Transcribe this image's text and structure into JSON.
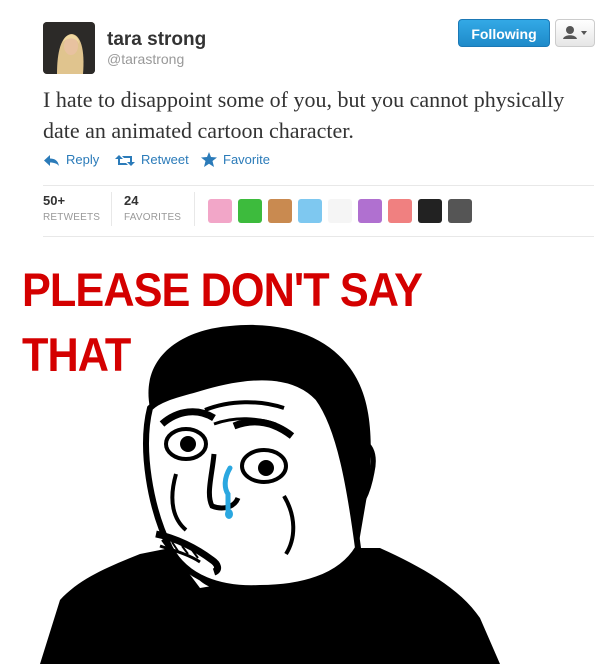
{
  "tweet": {
    "user_name": "tara strong",
    "handle": "@tarastrong",
    "follow_label": "Following",
    "text": "I hate to disappoint some of you, but you cannot physically date an animated cartoon character.",
    "actions": {
      "reply": "Reply",
      "retweet": "Retweet",
      "favorite": "Favorite"
    },
    "stats": {
      "retweets_count": "50+",
      "retweets_label": "RETWEETS",
      "favorites_count": "24",
      "favorites_label": "FAVORITES"
    },
    "accent_color": "#1e8ac9",
    "link_color": "#2b7bb9"
  },
  "favoriters": [
    {
      "color": "#f2a6c8",
      "icon": "pony-avatar"
    },
    {
      "color": "#3dbb3d",
      "icon": "green-avatar"
    },
    {
      "color": "#c98a50",
      "icon": "cartoon-avatar"
    },
    {
      "color": "#7ec8f0",
      "icon": "pony-avatar"
    },
    {
      "color": "#f5f5f5",
      "icon": "face-avatar"
    },
    {
      "color": "#b070d0",
      "icon": "pony-avatar"
    },
    {
      "color": "#f08080",
      "icon": "pony-avatar"
    },
    {
      "color": "#222222",
      "icon": "dark-avatar"
    },
    {
      "color": "#555555",
      "icon": "gray-avatar"
    }
  ],
  "meme": {
    "caption_line1": "PLEASE DON'T SAY",
    "caption_line2": "THAT",
    "caption_color": "#d40000"
  }
}
